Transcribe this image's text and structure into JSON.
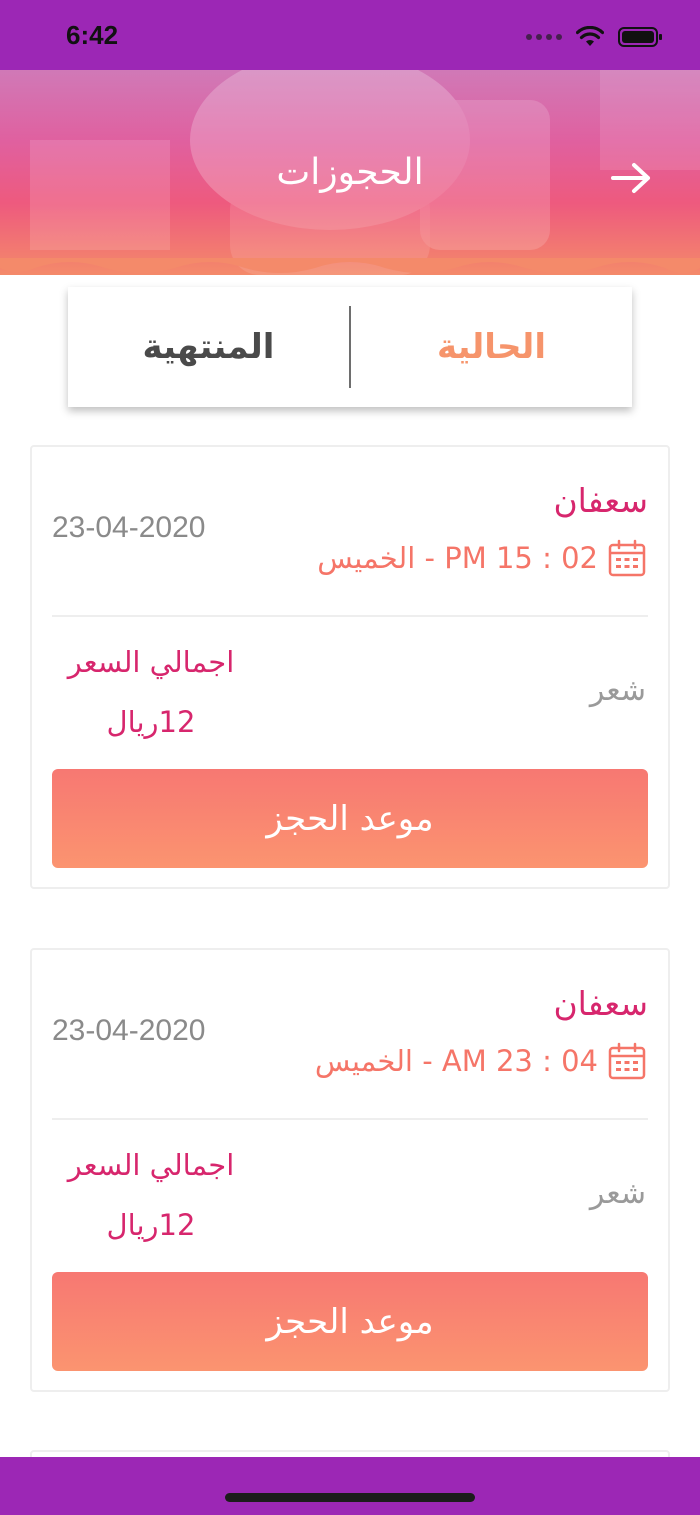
{
  "status_bar": {
    "time": "6:42"
  },
  "header": {
    "title": "الحجوزات",
    "back_icon": "arrow-right-icon"
  },
  "tabs": {
    "current_label": "الحالية",
    "ended_label": "المنتهية",
    "active": "current"
  },
  "bookings": [
    {
      "name": "سعفان",
      "date": "23-04-2020",
      "time": "02 : 15 PM - الخميس",
      "service": "شعر",
      "price_label": "اجمالي السعر",
      "price": "12ريال",
      "button_label": "موعد الحجز"
    },
    {
      "name": "سعفان",
      "date": "23-04-2020",
      "time": "04 : 23 AM - الخميس",
      "service": "شعر",
      "price_label": "اجمالي السعر",
      "price": "12ريال",
      "button_label": "موعد الحجز"
    }
  ],
  "colors": {
    "status_bar": "#9c27b5",
    "accent_pink": "#d7266d",
    "accent_orange": "#f6946b",
    "button_gradient_start": "#f77872",
    "button_gradient_end": "#fb9470"
  }
}
